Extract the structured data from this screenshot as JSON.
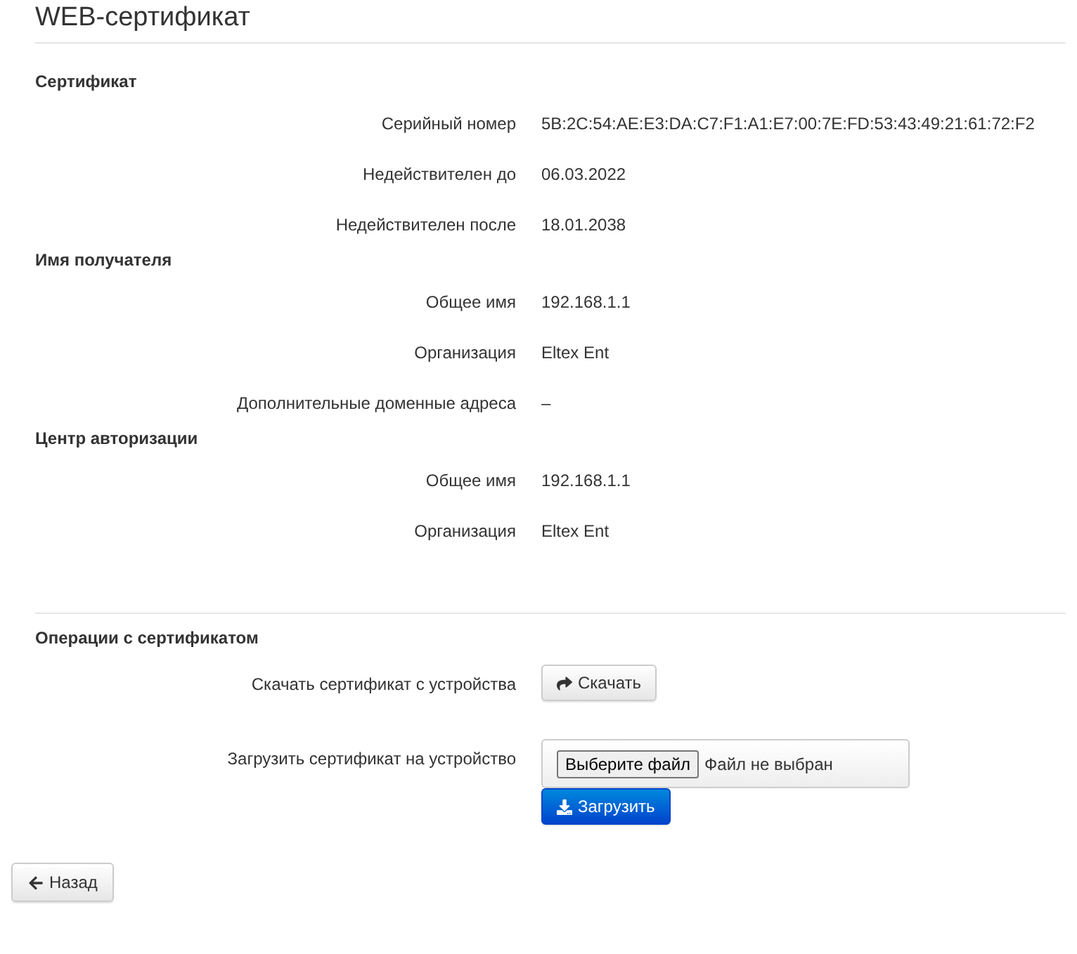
{
  "title": "WEB-сертификат",
  "sections": [
    {
      "heading": "Сертификат",
      "rows": [
        {
          "label": "Серийный номер",
          "value": "5B:2C:54:AE:E3:DA:C7:F1:A1:E7:00:7E:FD:53:43:49:21:61:72:F2"
        },
        {
          "label": "Недействителен до",
          "value": "06.03.2022"
        },
        {
          "label": "Недействителен после",
          "value": "18.01.2038"
        }
      ]
    },
    {
      "heading": "Имя получателя",
      "rows": [
        {
          "label": "Общее имя",
          "value": "192.168.1.1"
        },
        {
          "label": "Организация",
          "value": "Eltex Ent"
        },
        {
          "label": "Дополнительные доменные адреса",
          "value": "–"
        }
      ]
    },
    {
      "heading": "Центр авторизации",
      "rows": [
        {
          "label": "Общее имя",
          "value": "192.168.1.1"
        },
        {
          "label": "Организация",
          "value": "Eltex Ent"
        }
      ]
    }
  ],
  "operations": {
    "heading": "Операции с сертификатом",
    "download": {
      "label": "Скачать сертификат с устройства",
      "button": "Скачать"
    },
    "upload": {
      "label": "Загрузить сертификат на устройство",
      "choose_button": "Выберите файл",
      "file_status": "Файл не выбран",
      "button": "Загрузить"
    }
  },
  "back_button": "Назад"
}
